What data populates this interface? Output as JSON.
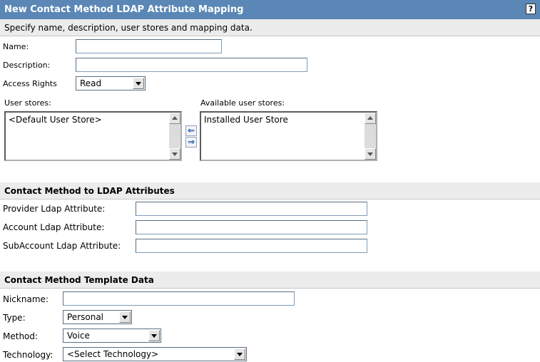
{
  "header": {
    "title": "New Contact Method LDAP Attribute Mapping",
    "help_label": "?",
    "subtitle": "Specify name, description, user stores and mapping data."
  },
  "general": {
    "name_label": "Name:",
    "name_value": "",
    "description_label": "Description:",
    "description_value": "",
    "access_rights_label": "Access Rights",
    "access_rights_value": "Read",
    "user_stores_label": "User stores:",
    "user_stores": [
      "<Default User Store>"
    ],
    "available_stores_label": "Available user stores:",
    "available_stores": [
      "Installed User Store"
    ],
    "move_left_icon": "arrow-left-icon",
    "move_right_icon": "arrow-right-icon",
    "move_left_glyph": "⇐",
    "move_right_glyph": "⇒"
  },
  "ldap": {
    "section_title": "Contact Method to LDAP Attributes",
    "provider_label": "Provider Ldap Attribute:",
    "provider_value": "",
    "account_label": "Account Ldap Attribute:",
    "account_value": "",
    "subaccount_label": "SubAccount Ldap Attribute:",
    "subaccount_value": ""
  },
  "template": {
    "section_title": "Contact Method Template Data",
    "nickname_label": "Nickname:",
    "nickname_value": "",
    "type_label": "Type:",
    "type_value": "Personal",
    "method_label": "Method:",
    "method_value": "Voice",
    "technology_label": "Technology:",
    "technology_value": "<Select Technology>"
  },
  "colors": {
    "titlebar": "#5a87b5",
    "section_bg": "#ececec",
    "arrow_blue": "#1b55b5"
  }
}
